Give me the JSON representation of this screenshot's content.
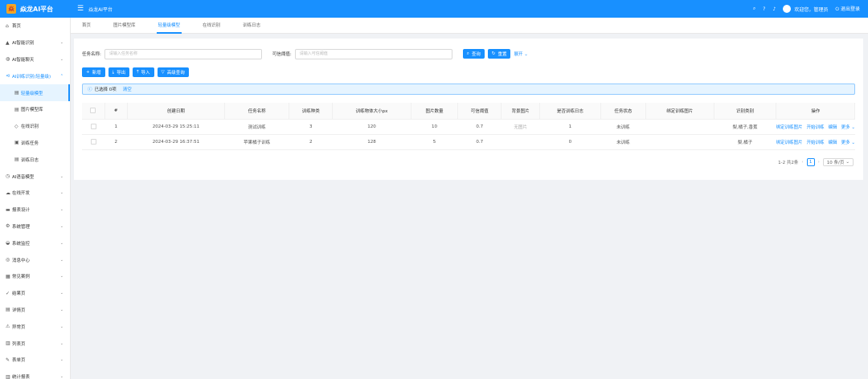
{
  "header": {
    "logo_glyph": "焱",
    "app_name": "焱龙AI平台",
    "menu_title": "焱龙AI平台",
    "welcome": "欢迎您，管理员",
    "logout": "退出登录"
  },
  "sidebar": {
    "items": [
      {
        "label": "首页",
        "icon": "⌂",
        "chevron": ""
      },
      {
        "label": "AI智能识别",
        "icon": "▲",
        "chevron": "⌄"
      },
      {
        "label": "AI智能聊天",
        "icon": "◍",
        "chevron": "⌄"
      },
      {
        "label": "AI训练识别(轻量级)",
        "icon": "⊲",
        "chevron": "⌃"
      },
      {
        "label": "轻量级模型",
        "icon": "▤",
        "chevron": ""
      },
      {
        "label": "图片模型库",
        "icon": "▤",
        "chevron": ""
      },
      {
        "label": "在线识别",
        "icon": "◇",
        "chevron": ""
      },
      {
        "label": "训练任务",
        "icon": "▣",
        "chevron": ""
      },
      {
        "label": "训练日志",
        "icon": "▤",
        "chevron": ""
      },
      {
        "label": "AI语音模型",
        "icon": "◷",
        "chevron": "⌄"
      },
      {
        "label": "在线开发",
        "icon": "☁",
        "chevron": "⌄"
      },
      {
        "label": "报表设计",
        "icon": "▬",
        "chevron": "⌄"
      },
      {
        "label": "系统管理",
        "icon": "⚙",
        "chevron": "⌄"
      },
      {
        "label": "系统监控",
        "icon": "◒",
        "chevron": "⌄"
      },
      {
        "label": "消息中心",
        "icon": "◎",
        "chevron": "⌄"
      },
      {
        "label": "常见案例",
        "icon": "▦",
        "chevron": "⌄"
      },
      {
        "label": "结果页",
        "icon": "✓",
        "chevron": "⌄"
      },
      {
        "label": "详情页",
        "icon": "▤",
        "chevron": "⌄"
      },
      {
        "label": "异常页",
        "icon": "⚠",
        "chevron": "⌄"
      },
      {
        "label": "列表页",
        "icon": "▥",
        "chevron": "⌄"
      },
      {
        "label": "表单页",
        "icon": "✎",
        "chevron": "⌄"
      },
      {
        "label": "统计报表",
        "icon": "▥",
        "chevron": "⌄"
      }
    ]
  },
  "tabs": [
    "首页",
    "图片模型库",
    "轻量级模型",
    "在线识别",
    "训练日志"
  ],
  "filter": {
    "task_label": "任务名称:",
    "task_placeholder": "请输入任务名称",
    "threshold_label": "可信阈值:",
    "threshold_placeholder": "请输入可信阈值",
    "search": "查询",
    "reset": "重置",
    "expand": "展开"
  },
  "toolbar": {
    "add": "新增",
    "export": "导出",
    "import": "导入",
    "advanced": "高级查询"
  },
  "selection": {
    "text": "已选择 0项",
    "clear": "清空"
  },
  "table": {
    "headers": [
      "",
      "#",
      "创建日期",
      "任务名称",
      "训练种类",
      "训练物体大小px",
      "图片数量",
      "可信阈值",
      "背景图片",
      "是否训练日志",
      "任务状态",
      "绑定训练图片",
      "识别类别",
      "操作"
    ],
    "rows": [
      {
        "idx": "1",
        "date": "2024-03-29 15:25:11",
        "name": "测试训练",
        "kinds": "3",
        "size": "120",
        "count": "10",
        "threshold": "0.7",
        "bg": "无图片",
        "log": "1",
        "status": "未训练",
        "bind": "",
        "classes": "梨,橘子,香蕉"
      },
      {
        "idx": "2",
        "date": "2024-03-29 16:37:51",
        "name": "苹果橘子训练",
        "kinds": "2",
        "size": "128",
        "count": "5",
        "threshold": "0.7",
        "bg": "",
        "log": "0",
        "status": "未训练",
        "bind": "",
        "classes": "梨,橘子"
      }
    ],
    "ops": [
      "绑定训练图片",
      "开始训练",
      "编辑",
      "更多"
    ]
  },
  "pager": {
    "total": "1-2 共2条",
    "page": "1",
    "size": "10 条/页"
  }
}
